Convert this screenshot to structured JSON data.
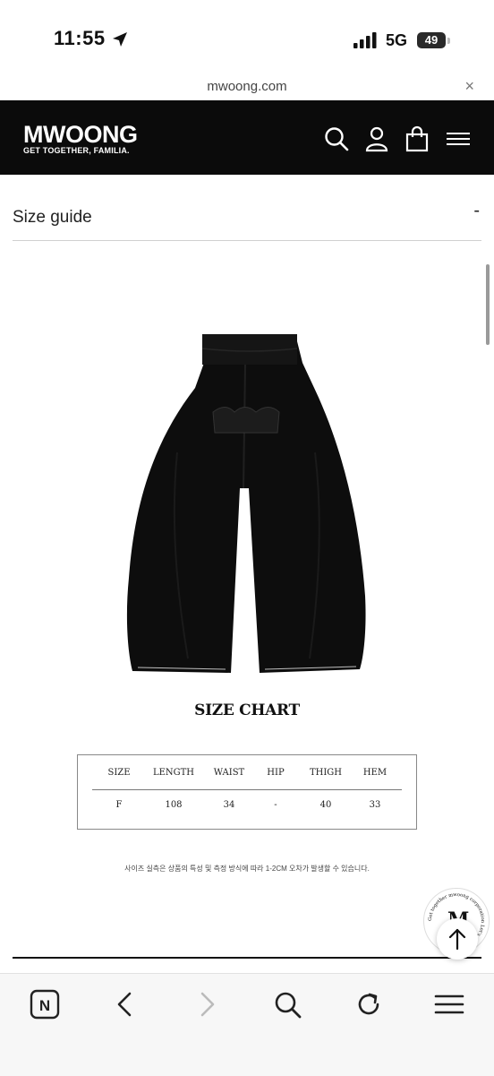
{
  "status_bar": {
    "time": "11:55",
    "network": "5G",
    "battery": "49"
  },
  "browser": {
    "url": "mwoong.com",
    "close_symbol": "×"
  },
  "header": {
    "logo": "MWOONG",
    "tagline": "GET TOGETHER, FAMILIA."
  },
  "size_guide": {
    "label": "Size guide",
    "collapse_symbol": "-"
  },
  "size_chart": {
    "title": "SIZE CHART",
    "columns": [
      "SIZE",
      "LENGTH",
      "WAIST",
      "HIP",
      "THIGH",
      "HEM"
    ],
    "rows": [
      [
        "F",
        "108",
        "34",
        "-",
        "40",
        "33"
      ]
    ]
  },
  "note": "사이즈 실측은 상품의 특성 및 측정 방식에 따라 1-2CM 오차가 발생할 수 있습니다.",
  "badge_text": "Get together mwoong corporation Let's get together",
  "toolbar": {
    "home_label": "N"
  },
  "icons": [
    "location-arrow-icon",
    "signal-icon",
    "search-icon",
    "user-icon",
    "bag-icon",
    "menu-icon",
    "close-icon",
    "back-icon",
    "forward-icon",
    "reload-icon",
    "arrow-up-icon"
  ]
}
